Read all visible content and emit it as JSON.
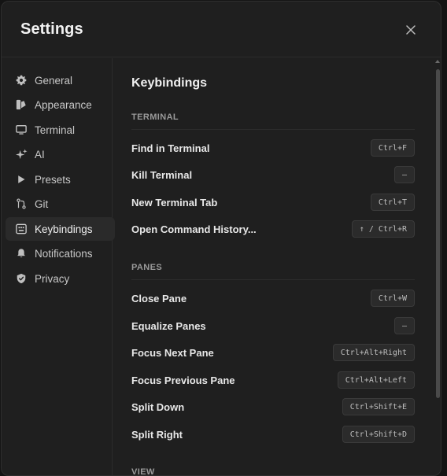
{
  "dialog": {
    "title": "Settings",
    "close_icon": "close-icon"
  },
  "sidebar": {
    "items": [
      {
        "label": "General",
        "icon": "gear-icon",
        "active": false
      },
      {
        "label": "Appearance",
        "icon": "palette-icon",
        "active": false
      },
      {
        "label": "Terminal",
        "icon": "monitor-icon",
        "active": false
      },
      {
        "label": "AI",
        "icon": "sparkles-icon",
        "active": false
      },
      {
        "label": "Presets",
        "icon": "play-icon",
        "active": false
      },
      {
        "label": "Git",
        "icon": "git-branch-icon",
        "active": false
      },
      {
        "label": "Keybindings",
        "icon": "keyboard-icon",
        "active": true
      },
      {
        "label": "Notifications",
        "icon": "bell-icon",
        "active": false
      },
      {
        "label": "Privacy",
        "icon": "shield-icon",
        "active": false
      }
    ]
  },
  "main": {
    "section_title": "Keybindings",
    "groups": [
      {
        "name": "TERMINAL",
        "rows": [
          {
            "label": "Find in Terminal",
            "shortcut": "Ctrl+F"
          },
          {
            "label": "Kill Terminal",
            "shortcut": "—"
          },
          {
            "label": "New Terminal Tab",
            "shortcut": "Ctrl+T"
          },
          {
            "label": "Open Command History...",
            "shortcut": "↑ / Ctrl+R"
          }
        ]
      },
      {
        "name": "PANES",
        "rows": [
          {
            "label": "Close Pane",
            "shortcut": "Ctrl+W"
          },
          {
            "label": "Equalize Panes",
            "shortcut": "—"
          },
          {
            "label": "Focus Next Pane",
            "shortcut": "Ctrl+Alt+Right"
          },
          {
            "label": "Focus Previous Pane",
            "shortcut": "Ctrl+Alt+Left"
          },
          {
            "label": "Split Down",
            "shortcut": "Ctrl+Shift+E"
          },
          {
            "label": "Split Right",
            "shortcut": "Ctrl+Shift+D"
          }
        ]
      },
      {
        "name": "VIEW",
        "rows": []
      }
    ]
  },
  "colors": {
    "background": "#1f1f1f",
    "border": "#2c2c2c",
    "active_item": "#2a2a2a",
    "kbd_bg": "#2b2b2b"
  }
}
